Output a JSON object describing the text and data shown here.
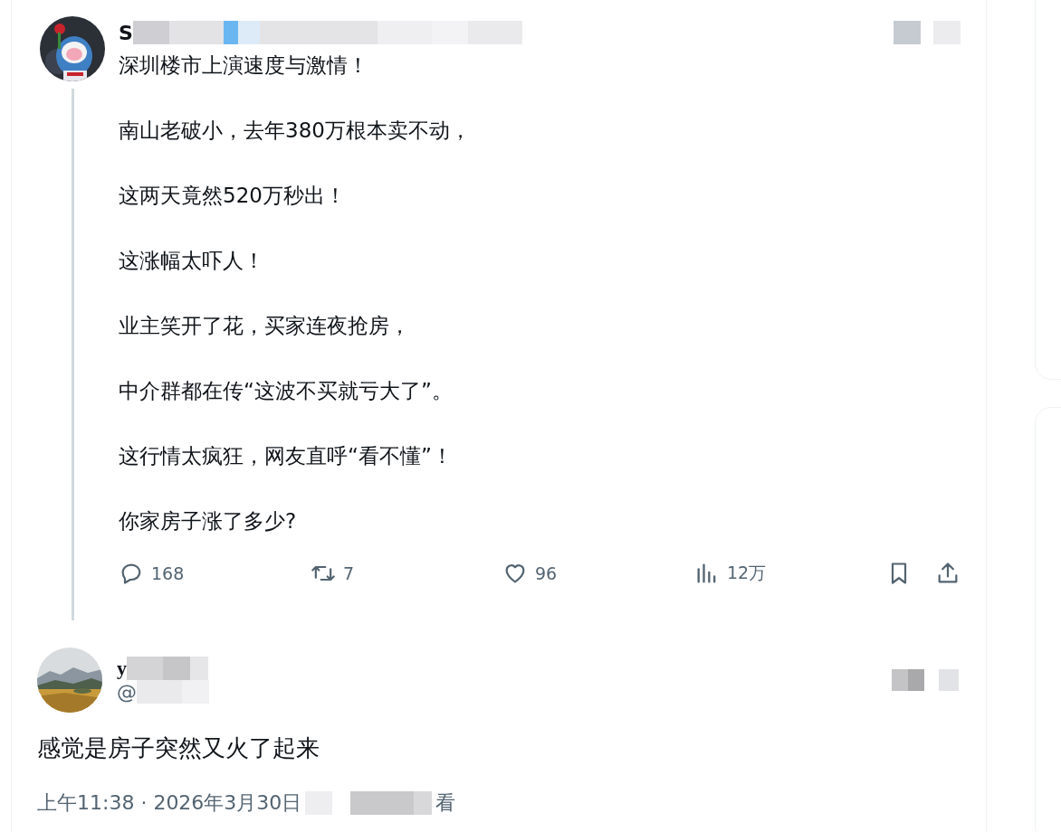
{
  "post": {
    "name_visible": "S",
    "paragraphs": [
      "深圳楼市上演速度与激情！",
      "南山老破小，去年380万根本卖不动，",
      "这两天竟然520万秒出！",
      "这涨幅太吓人！",
      "业主笑开了花，买家连夜抢房，",
      "中介群都在传“这波不买就亏大了”。",
      "这行情太疯狂，网友直呼“看不懂”！",
      "你家房子涨了多少?"
    ],
    "actions": [
      {
        "kind": "reply",
        "count": "168"
      },
      {
        "kind": "repost",
        "count": "7"
      },
      {
        "kind": "like",
        "count": "96"
      },
      {
        "kind": "views",
        "count": "12万"
      }
    ],
    "side_actions": [
      {
        "kind": "bookmark"
      },
      {
        "kind": "share"
      }
    ]
  },
  "reply": {
    "name_visible": "y",
    "handle_visible": "@",
    "text": "感觉是房子突然又火了起来",
    "timestamp": "上午11:38 · 2026年3月30日",
    "views_suffix": "看"
  }
}
